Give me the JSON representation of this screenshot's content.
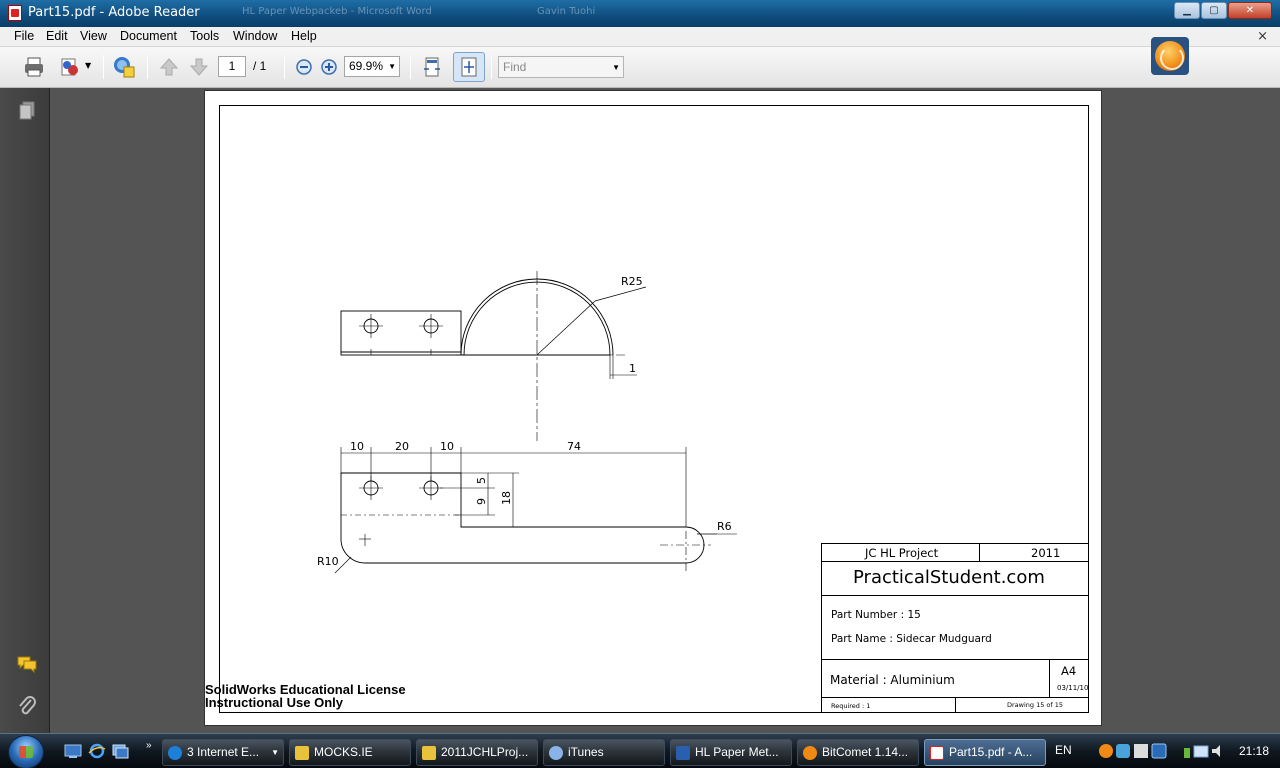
{
  "window": {
    "title": "Part15.pdf - Adobe Reader",
    "ghost_titles": [
      "HL Paper Webpackeb - Microsoft Word",
      "Gavin Tuohi"
    ],
    "buttons": {
      "minimize": "▁",
      "maximize": "▢",
      "close": "✕"
    }
  },
  "menu": [
    "File",
    "Edit",
    "View",
    "Document",
    "Tools",
    "Window",
    "Help"
  ],
  "menu_close": "×",
  "toolbar": {
    "page_current": "1",
    "page_total": "/ 1",
    "zoom": "69.9%",
    "find_placeholder": "Find"
  },
  "drawing": {
    "dims": {
      "r25": "R25",
      "thickness": "1",
      "d10a": "10",
      "d20": "20",
      "d10b": "10",
      "d74": "74",
      "d5": "5",
      "d9": "9",
      "d18": "18",
      "r6": "R6",
      "r10": "R10"
    },
    "license_line1": "SolidWorks Educational License",
    "license_line2": "Instructional Use Only",
    "title_block": {
      "project": "JC HL Project",
      "year": "2011",
      "site": "PracticalStudent.com",
      "part_number": "Part Number : 15",
      "part_name": "Part Name : Sidecar Mudguard",
      "material": "Material : Aluminium",
      "size": "A4",
      "date": "03/11/10",
      "required": "Required : 1",
      "drawing_no": "Drawing 15 of 15"
    }
  },
  "taskbar": {
    "buttons": [
      {
        "label": "3 Internet E...",
        "color": "#1e7fd8",
        "active": false,
        "grouped": true
      },
      {
        "label": "MOCKS.IE",
        "color": "#e8c23a",
        "active": false,
        "grouped": false
      },
      {
        "label": "2011JCHLProj...",
        "color": "#e8c23a",
        "active": false,
        "grouped": false
      },
      {
        "label": "iTunes",
        "color": "#8ab4e8",
        "active": false,
        "grouped": false
      },
      {
        "label": "HL Paper Met...",
        "color": "#2a5fb0",
        "active": false,
        "grouped": false
      },
      {
        "label": "BitComet 1.14...",
        "color": "#f08a15",
        "active": false,
        "grouped": false
      },
      {
        "label": "Part15.pdf - A...",
        "color": "#d22",
        "active": true,
        "grouped": false
      }
    ],
    "lang": "EN",
    "clock": "21:18"
  }
}
